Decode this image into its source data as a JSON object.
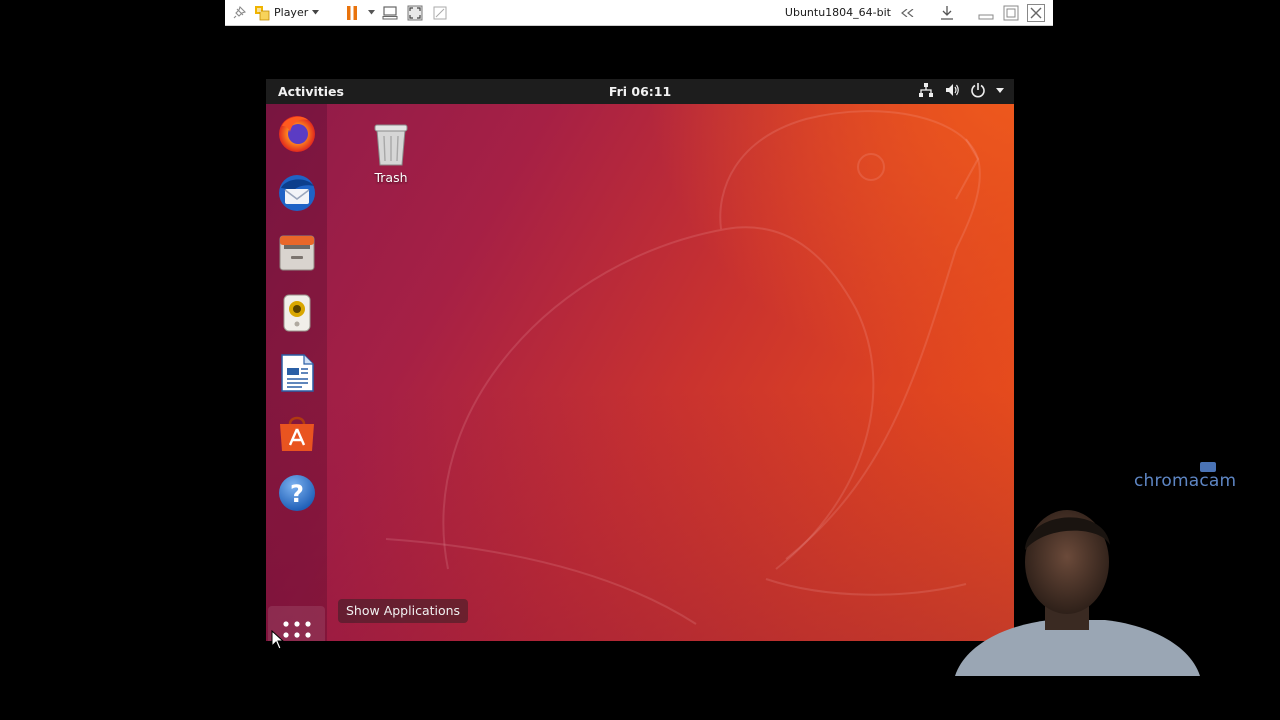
{
  "vm_toolbar": {
    "player_label": "Player",
    "vm_name": "Ubuntu1804_64-bit"
  },
  "topbar": {
    "activities_label": "Activities",
    "clock": "Fri 06:11"
  },
  "dock": {
    "items": [
      {
        "name": "Firefox",
        "icon": "firefox-icon"
      },
      {
        "name": "Thunderbird",
        "icon": "thunderbird-icon"
      },
      {
        "name": "Files",
        "icon": "files-icon"
      },
      {
        "name": "Rhythmbox",
        "icon": "rhythmbox-icon"
      },
      {
        "name": "LibreOffice Writer",
        "icon": "writer-icon"
      },
      {
        "name": "Ubuntu Software",
        "icon": "software-icon"
      },
      {
        "name": "Help",
        "icon": "help-icon"
      }
    ],
    "show_apps_tooltip": "Show Applications"
  },
  "desktop": {
    "icons": [
      {
        "label": "Trash",
        "icon": "trash-icon"
      }
    ]
  },
  "overlay": {
    "watermark": "chromacam"
  },
  "colors": {
    "ubuntu_orange": "#e95420",
    "aubergine": "#8e1b4a",
    "topbar": "#1d1d1d"
  }
}
